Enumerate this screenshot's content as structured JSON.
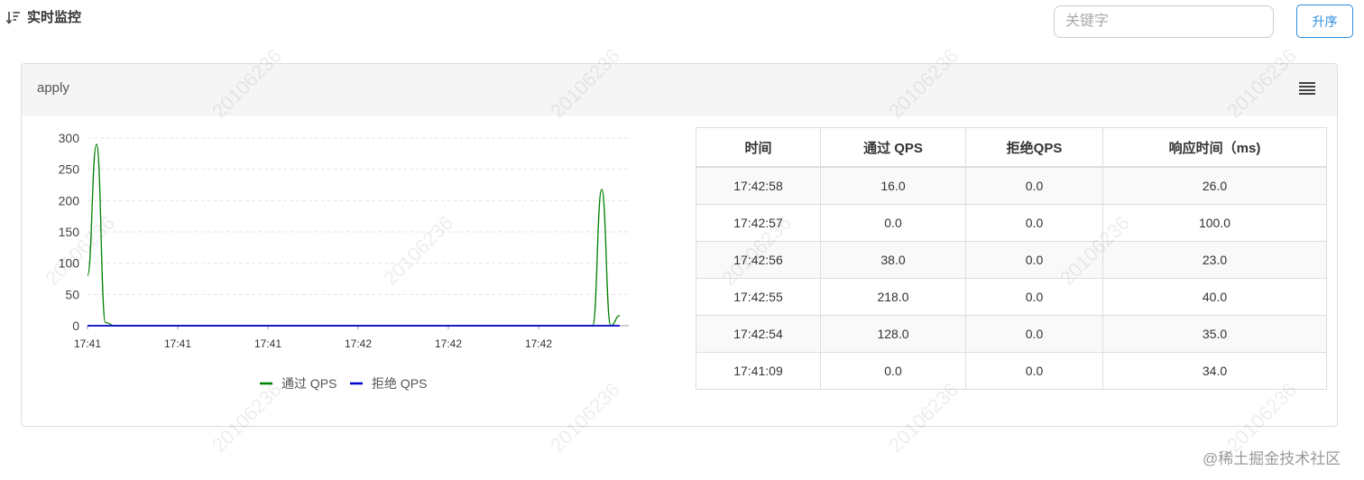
{
  "header": {
    "icon": "sort-descending-icon",
    "title": "实时监控",
    "search_placeholder": "关键字",
    "search_value": "",
    "sort_button_label": "升序"
  },
  "panel": {
    "title": "apply",
    "menu_icon": "hamburger-menu-icon"
  },
  "chart_data": {
    "type": "line",
    "title": "",
    "xlabel": "",
    "ylabel": "",
    "ylim": [
      0,
      300
    ],
    "yticks": [
      0,
      50,
      100,
      150,
      200,
      250,
      300
    ],
    "xtick_labels": [
      "17:41",
      "17:41",
      "17:41",
      "17:42",
      "17:42",
      "17:42"
    ],
    "grid": true,
    "legend_position": "bottom",
    "x": [
      0,
      1,
      2,
      3,
      4,
      5,
      6,
      7,
      8,
      9,
      10,
      11,
      12,
      13,
      14,
      15,
      16,
      17,
      18,
      19,
      20,
      21,
      22,
      23,
      24,
      25,
      26,
      27,
      28,
      29,
      30,
      31,
      32,
      33,
      34,
      35,
      36,
      37,
      38,
      39,
      40,
      41,
      42,
      43,
      44,
      45,
      46,
      47,
      48,
      49,
      50,
      51,
      52,
      53,
      54,
      55,
      56,
      57,
      58,
      59,
      60
    ],
    "series": [
      {
        "name": "通过 QPS",
        "color": "#008000",
        "values": [
          80,
          290,
          5,
          0,
          0,
          0,
          0,
          0,
          0,
          0,
          0,
          0,
          0,
          0,
          0,
          0,
          0,
          0,
          0,
          0,
          0,
          0,
          0,
          0,
          0,
          0,
          0,
          0,
          0,
          0,
          0,
          0,
          0,
          0,
          0,
          0,
          0,
          0,
          0,
          0,
          0,
          0,
          0,
          0,
          0,
          0,
          0,
          0,
          0,
          0,
          0,
          0,
          0,
          0,
          0,
          0,
          0,
          218,
          0,
          16
        ]
      },
      {
        "name": "拒绝 QPS",
        "color": "#0000cc",
        "values": [
          0,
          0,
          0,
          0,
          0,
          0,
          0,
          0,
          0,
          0,
          0,
          0,
          0,
          0,
          0,
          0,
          0,
          0,
          0,
          0,
          0,
          0,
          0,
          0,
          0,
          0,
          0,
          0,
          0,
          0,
          0,
          0,
          0,
          0,
          0,
          0,
          0,
          0,
          0,
          0,
          0,
          0,
          0,
          0,
          0,
          0,
          0,
          0,
          0,
          0,
          0,
          0,
          0,
          0,
          0,
          0,
          0,
          0,
          0,
          0
        ]
      }
    ]
  },
  "table": {
    "columns": [
      "时间",
      "通过 QPS",
      "拒绝QPS",
      "响应时间（ms)"
    ],
    "rows": [
      [
        "17:42:58",
        "16.0",
        "0.0",
        "26.0"
      ],
      [
        "17:42:57",
        "0.0",
        "0.0",
        "100.0"
      ],
      [
        "17:42:56",
        "38.0",
        "0.0",
        "23.0"
      ],
      [
        "17:42:55",
        "218.0",
        "0.0",
        "40.0"
      ],
      [
        "17:42:54",
        "128.0",
        "0.0",
        "35.0"
      ],
      [
        "17:41:09",
        "0.0",
        "0.0",
        "34.0"
      ]
    ]
  },
  "watermark": "20106236",
  "credit": "@稀土掘金技术社区"
}
